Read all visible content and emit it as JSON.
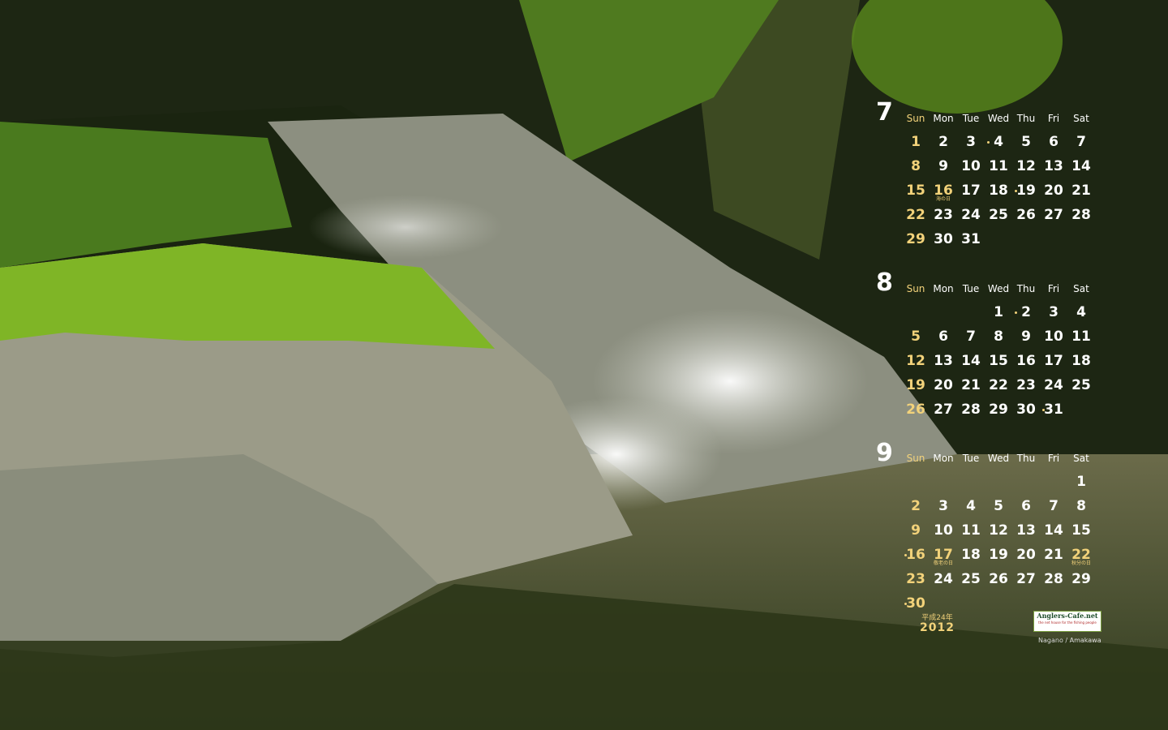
{
  "colors": {
    "holiday": "#f2d27a",
    "text": "#ffffff"
  },
  "weekdays": [
    "Sun",
    "Mon",
    "Tue",
    "Wed",
    "Thu",
    "Fri",
    "Sat"
  ],
  "months": [
    {
      "number": "7",
      "days": [
        [
          "1",
          "2",
          "3",
          "4",
          "5",
          "6",
          "7"
        ],
        [
          "8",
          "9",
          "10",
          "11",
          "12",
          "13",
          "14"
        ],
        [
          "15",
          "16",
          "17",
          "18",
          "19",
          "20",
          "21"
        ],
        [
          "22",
          "23",
          "24",
          "25",
          "26",
          "27",
          "28"
        ],
        [
          "29",
          "30",
          "31",
          "",
          "",
          "",
          ""
        ]
      ],
      "note": "海の日"
    },
    {
      "number": "8",
      "days": [
        [
          "",
          "",
          "",
          "1",
          "2",
          "3",
          "4"
        ],
        [
          "5",
          "6",
          "7",
          "8",
          "9",
          "10",
          "11"
        ],
        [
          "12",
          "13",
          "14",
          "15",
          "16",
          "17",
          "18"
        ],
        [
          "19",
          "20",
          "21",
          "22",
          "23",
          "24",
          "25"
        ],
        [
          "26",
          "27",
          "28",
          "29",
          "30",
          "31",
          ""
        ]
      ]
    },
    {
      "number": "9",
      "days": [
        [
          "",
          "",
          "",
          "",
          "",
          "",
          "1"
        ],
        [
          "2",
          "3",
          "4",
          "5",
          "6",
          "7",
          "8"
        ],
        [
          "9",
          "10",
          "11",
          "12",
          "13",
          "14",
          "15"
        ],
        [
          "16",
          "17",
          "18",
          "19",
          "20",
          "21",
          "22"
        ],
        [
          "23",
          "24",
          "25",
          "26",
          "27",
          "28",
          "29"
        ],
        [
          "30",
          "",
          "",
          "",
          "",
          "",
          ""
        ]
      ],
      "note_a": "敬老の日",
      "note_b": "秋分の日"
    }
  ],
  "year": {
    "era": "平成24年",
    "value": "2012"
  },
  "logo": {
    "name": "Anglers-Cafe.net",
    "tagline": "the net house for the fishing people"
  },
  "credit": "Nagano / Amakawa"
}
